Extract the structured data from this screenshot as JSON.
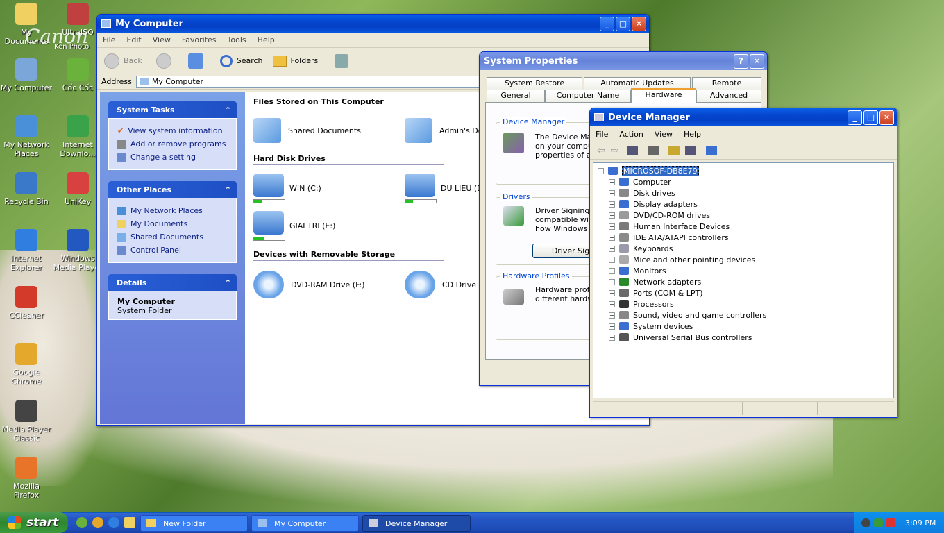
{
  "desktop": {
    "icons": [
      {
        "label": "My Documents",
        "color": "#f0d060"
      },
      {
        "label": "UltraISO",
        "color": "#c04040"
      },
      {
        "label": "My Computer",
        "color": "#7aa6d9"
      },
      {
        "label": "Cốc Cốc",
        "color": "#6ab23c"
      },
      {
        "label": "My Network Places",
        "color": "#4a90d9"
      },
      {
        "label": "Internet Downlo...",
        "color": "#3aa34a"
      },
      {
        "label": "Recycle Bin",
        "color": "#3a78c9"
      },
      {
        "label": "UniKey",
        "color": "#d94040"
      },
      {
        "label": "Internet Explorer",
        "color": "#2f7ee0"
      },
      {
        "label": "Windows Media Player",
        "color": "#2258c0"
      },
      {
        "label": "CCleaner",
        "color": "#d33a2a"
      },
      {
        "label": "Google Chrome",
        "color": "#e4a82c"
      },
      {
        "label": "Media Player Classic",
        "color": "#444444"
      },
      {
        "label": "Mozilla Firefox",
        "color": "#e8742a"
      }
    ],
    "watermark": "Canon",
    "watermark2": "Ken Photo"
  },
  "mycomputer": {
    "title": "My Computer",
    "menu": [
      "File",
      "Edit",
      "View",
      "Favorites",
      "Tools",
      "Help"
    ],
    "toolbar": {
      "back": "Back",
      "search": "Search",
      "folders": "Folders"
    },
    "address_label": "Address",
    "address_value": "My Computer",
    "system_tasks": {
      "title": "System Tasks",
      "items": [
        "View system information",
        "Add or remove programs",
        "Change a setting"
      ]
    },
    "other_places": {
      "title": "Other Places",
      "items": [
        "My Network Places",
        "My Documents",
        "Shared Documents",
        "Control Panel"
      ]
    },
    "details": {
      "title": "Details",
      "name": "My Computer",
      "type": "System Folder"
    },
    "files_section": "Files Stored on This Computer",
    "files": [
      "Shared Documents",
      "Admin's Do"
    ],
    "hdd_section": "Hard Disk Drives",
    "drives": [
      {
        "label": "WIN (C:)",
        "fill": 0.25
      },
      {
        "label": "DU LIEU (D",
        "fill": 0.25
      },
      {
        "label": "GIAI TRI (E:)",
        "fill": 0.35
      }
    ],
    "removable_section": "Devices with Removable Storage",
    "removable": [
      "DVD-RAM Drive (F:)",
      "CD Drive (G"
    ]
  },
  "sysprops": {
    "title": "System Properties",
    "tabs_top": [
      "System Restore",
      "Automatic Updates",
      "Remote"
    ],
    "tabs_bottom": [
      "General",
      "Computer Name",
      "Hardware",
      "Advanced"
    ],
    "device_manager": {
      "label": "Device Manager",
      "text1": "The Device Mar",
      "text2": "on your compute",
      "text3": "properties of any"
    },
    "drivers": {
      "label": "Drivers",
      "text1": "Driver Signing le",
      "text2": "compatible with W",
      "text3": "how Windows co",
      "button": "Driver Sig"
    },
    "profiles": {
      "label": "Hardware Profiles",
      "text1": "Hardware profile",
      "text2": "different hardwar"
    }
  },
  "devmgr": {
    "title": "Device Manager",
    "menu": [
      "File",
      "Action",
      "View",
      "Help"
    ],
    "root": "MICROSOF-DB8E79",
    "nodes": [
      {
        "label": "Computer",
        "color": "#3a6ed0"
      },
      {
        "label": "Disk drives",
        "color": "#888888"
      },
      {
        "label": "Display adapters",
        "color": "#3a6ed0"
      },
      {
        "label": "DVD/CD-ROM drives",
        "color": "#9a9a9a"
      },
      {
        "label": "Human Interface Devices",
        "color": "#7a7a7a"
      },
      {
        "label": "IDE ATA/ATAPI controllers",
        "color": "#8a8a8a"
      },
      {
        "label": "Keyboards",
        "color": "#9a9aaa"
      },
      {
        "label": "Mice and other pointing devices",
        "color": "#aaaaaa"
      },
      {
        "label": "Monitors",
        "color": "#3a6ed0"
      },
      {
        "label": "Network adapters",
        "color": "#2a8a2a"
      },
      {
        "label": "Ports (COM & LPT)",
        "color": "#6a6a6a"
      },
      {
        "label": "Processors",
        "color": "#333333"
      },
      {
        "label": "Sound, video and game controllers",
        "color": "#888888"
      },
      {
        "label": "System devices",
        "color": "#3a6ed0"
      },
      {
        "label": "Universal Serial Bus controllers",
        "color": "#555555"
      }
    ]
  },
  "taskbar": {
    "start": "start",
    "items": [
      "New Folder",
      "My Computer",
      "Device Manager"
    ],
    "clock": "3:09 PM"
  }
}
